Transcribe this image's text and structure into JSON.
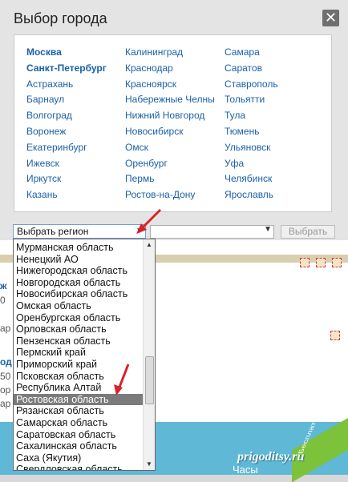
{
  "modal": {
    "title": "Выбор города",
    "close_label": "✕"
  },
  "cities": {
    "col1": [
      {
        "name": "Москва",
        "bold": true
      },
      {
        "name": "Санкт-Петербург",
        "bold": true
      },
      {
        "name": "Астрахань"
      },
      {
        "name": "Барнаул"
      },
      {
        "name": "Волгоград"
      },
      {
        "name": "Воронеж"
      },
      {
        "name": "Екатеринбург"
      },
      {
        "name": "Ижевск"
      },
      {
        "name": "Иркутск"
      },
      {
        "name": "Казань"
      }
    ],
    "col2": [
      {
        "name": "Калининград"
      },
      {
        "name": "Краснодар"
      },
      {
        "name": "Красноярск"
      },
      {
        "name": "Набережные Челны"
      },
      {
        "name": "Нижний Новгород"
      },
      {
        "name": "Новосибирск"
      },
      {
        "name": "Омск"
      },
      {
        "name": "Оренбург"
      },
      {
        "name": "Пермь"
      },
      {
        "name": "Ростов-на-Дону"
      }
    ],
    "col3": [
      {
        "name": "Самара"
      },
      {
        "name": "Саратов"
      },
      {
        "name": "Ставрополь"
      },
      {
        "name": "Тольятти"
      },
      {
        "name": "Тула"
      },
      {
        "name": "Тюмень"
      },
      {
        "name": "Ульяновск"
      },
      {
        "name": "Уфа"
      },
      {
        "name": "Челябинск"
      },
      {
        "name": "Ярославль"
      }
    ]
  },
  "region_select": {
    "value": "Выбрать регион"
  },
  "city_select": {
    "value": ""
  },
  "choose_button": "Выбрать",
  "region_options": [
    "Мурманская область",
    "Ненецкий АО",
    "Нижегородская область",
    "Новгородская область",
    "Новосибирская область",
    "Омская область",
    "Оренбургская область",
    "Орловская область",
    "Пензенская область",
    "Пермский край",
    "Приморский край",
    "Псковская область",
    "Республика Алтай",
    "Ростовская область",
    "Рязанская область",
    "Самарская область",
    "Саратовская область",
    "Сахалинская область",
    "Саха (Якутия)",
    "Свердловская область"
  ],
  "selected_region": "Ростовская область",
  "background": {
    "fragments": [
      "ж",
      "0",
      "ар",
      "од",
      "50",
      "ор",
      "ар"
    ],
    "footer_text": "Часы",
    "corner_badge": "Бесплатная доставка"
  },
  "watermark": "prigoditsy.ru",
  "colors": {
    "link": "#1a5fa8",
    "selected_bg": "#7b7b7b",
    "arrow_red": "#d8232a"
  }
}
